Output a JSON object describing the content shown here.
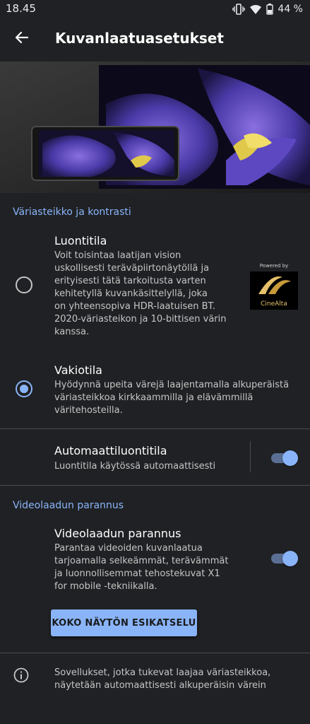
{
  "status_bar": {
    "time": "18.45",
    "battery_percent": "44 %",
    "icons": [
      "vibrate-icon",
      "wifi-icon",
      "battery-icon"
    ]
  },
  "app_bar": {
    "title": "Kuvanlaatuasetukset",
    "back_icon": "arrow-back-icon"
  },
  "colors": {
    "background": "#1f2124",
    "accent": "#8ab4f8",
    "text_primary": "#ffffff",
    "text_secondary": "#c4c7c5"
  },
  "color_section": {
    "header": "Väriasteikko ja kontrasti",
    "options": [
      {
        "title": "Luontitila",
        "description": "Voit toisintaa laatijan vision\nuskollisesti teräväpiirtonäytöllä ja\nerityisesti tätä tarkoitusta varten\nkehitetyllä kuvankäsittelyllä, joka\non yhteensopiva HDR-laatuisen BT.\n2020-väriasteikon ja 10-bittisen värin\nkanssa.",
        "selected": false
      },
      {
        "title": "Vakiotila",
        "description": "Hyödynnä upeita värejä laajentamalla alkuperäistä\nväriasteikkoa kirkkaammilla ja elävämmillä\nväritehosteilla.",
        "selected": true
      }
    ],
    "badge": {
      "powered_by": "Powered by",
      "brand": "CineAlta"
    },
    "auto_mode": {
      "title": "Automaattiluontitila",
      "description": "Luontitila käytössä automaattisesti",
      "enabled": true
    }
  },
  "video_section": {
    "header": "Videolaadun parannus",
    "setting": {
      "title": "Videolaadun parannus",
      "description": "Parantaa videoiden kuvanlaatua\ntarjoamalla selkeämmät, terävämmät\nja luonnollisemmat tehostekuvat X1\nfor mobile -tekniikalla.",
      "enabled": true
    },
    "preview_button": "KOKO NÄYTÖN ESIKATSELU"
  },
  "info": {
    "icon": "info-icon",
    "text": "Sovellukset, jotka tukevat laajaa väriasteikkoa,\nnäytetään automaattisesti alkuperäisin värein"
  }
}
